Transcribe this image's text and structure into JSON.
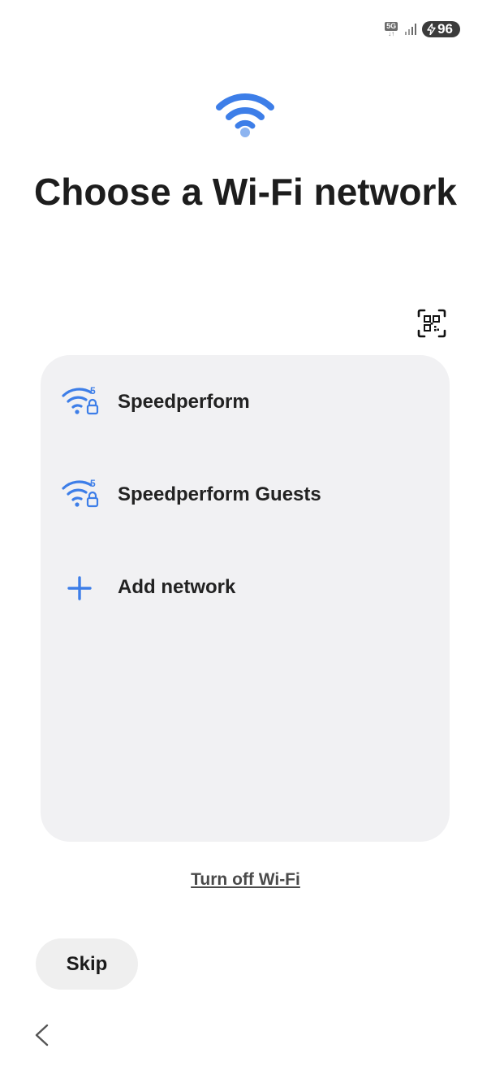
{
  "status_bar": {
    "network_type": "5G",
    "network_arrows": "↓↑",
    "battery_level": "96",
    "charging_icon": "bolt-icon"
  },
  "header": {
    "icon": "wifi-icon",
    "title": "Choose a Wi-Fi network"
  },
  "qr_scan": {
    "icon": "qr-code-scan-icon"
  },
  "networks": [
    {
      "name": "Speedperform",
      "band": "5",
      "secured": true,
      "icon": "wifi-5ghz-locked-icon"
    },
    {
      "name": "Speedperform Guests",
      "band": "5",
      "secured": true,
      "icon": "wifi-5ghz-locked-icon"
    }
  ],
  "add_network": {
    "label": "Add network",
    "icon": "plus-icon"
  },
  "turn_off_wifi": {
    "label": "Turn off Wi-Fi"
  },
  "skip": {
    "label": "Skip"
  },
  "nav": {
    "back_icon": "chevron-left-icon"
  },
  "colors": {
    "accent_blue": "#3d7ee8",
    "accent_light_blue": "#8db4f0",
    "card_background": "#f1f1f3",
    "title_text": "#1d1d1d"
  }
}
